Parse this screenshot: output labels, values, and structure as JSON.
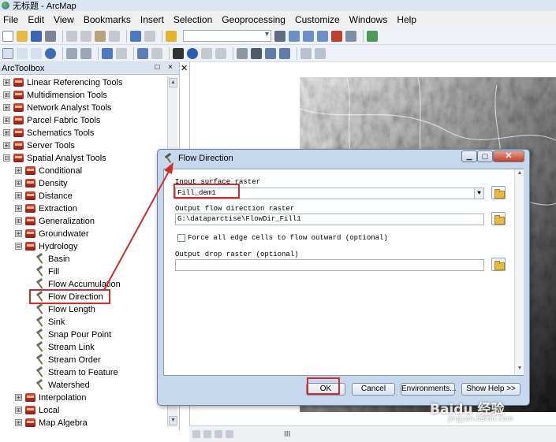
{
  "window": {
    "title": "无标题 - ArcMap"
  },
  "menu": [
    "File",
    "Edit",
    "View",
    "Bookmarks",
    "Insert",
    "Selection",
    "Geoprocessing",
    "Customize",
    "Windows",
    "Help"
  ],
  "toolbox": {
    "title": "ArcToolbox",
    "header_controls": "□ ×",
    "toolsets": [
      {
        "label": "Linear Referencing Tools",
        "expander": "⊞"
      },
      {
        "label": "Multidimension Tools",
        "expander": "⊞"
      },
      {
        "label": "Network Analyst Tools",
        "expander": "⊞"
      },
      {
        "label": "Parcel Fabric Tools",
        "expander": "⊞"
      },
      {
        "label": "Schematics Tools",
        "expander": "⊞"
      },
      {
        "label": "Server Tools",
        "expander": "⊞"
      },
      {
        "label": "Spatial Analyst Tools",
        "expander": "⊟"
      }
    ],
    "spatial_analyst_children": [
      {
        "label": "Conditional",
        "expander": "⊞"
      },
      {
        "label": "Density",
        "expander": "⊞"
      },
      {
        "label": "Distance",
        "expander": "⊞"
      },
      {
        "label": "Extraction",
        "expander": "⊞"
      },
      {
        "label": "Generalization",
        "expander": "⊞"
      },
      {
        "label": "Groundwater",
        "expander": "⊞"
      },
      {
        "label": "Hydrology",
        "expander": "⊟"
      }
    ],
    "hydrology_tools": [
      "Basin",
      "Fill",
      "Flow Accumulation",
      "Flow Direction",
      "Flow Length",
      "Sink",
      "Snap Pour Point",
      "Stream Link",
      "Stream Order",
      "Stream to Feature",
      "Watershed"
    ],
    "selected_tool": "Flow Direction",
    "after_hydrology": [
      {
        "label": "Interpolation",
        "expander": "⊞"
      },
      {
        "label": "Local",
        "expander": "⊞"
      },
      {
        "label": "Map Algebra",
        "expander": "⊞"
      }
    ]
  },
  "dialog": {
    "title": "Flow Direction",
    "input_surface_label": "Input surface raster",
    "input_surface_value": "Fill_dem1",
    "output_flow_label": "Output flow direction raster",
    "output_flow_value": "G:\\dataparctise\\FlowDir_Fill1",
    "force_edge_label": "Force all edge cells to flow outward (optional)",
    "output_drop_label": "Output drop raster (optional)",
    "output_drop_value": "",
    "buttons": {
      "ok": "OK",
      "cancel": "Cancel",
      "environments": "Environments...",
      "show_help": "Show Help >>"
    }
  },
  "statusbar": {
    "scroll_handle": "III"
  },
  "watermark": {
    "text": "Baidu 经验",
    "sub": "jingyan.baidu.com"
  },
  "colors": {
    "highlight": "#d62b2b",
    "dialog_frame": "#c6d8ee",
    "toolbar": "#eef1f6"
  }
}
